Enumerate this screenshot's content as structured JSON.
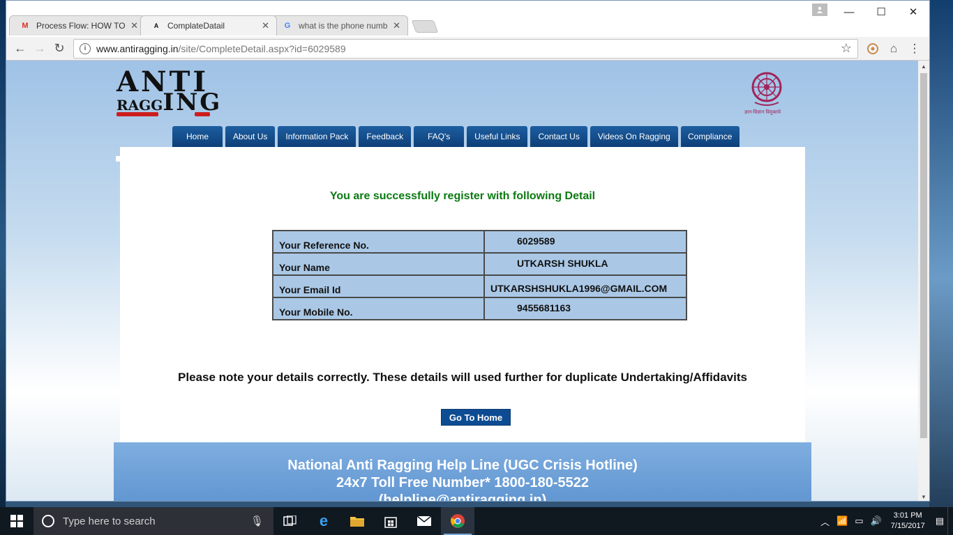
{
  "browser": {
    "tabs": [
      {
        "title": "Process Flow: HOW TO F",
        "icon": "gmail-icon",
        "icon_glyph": "M",
        "active": false
      },
      {
        "title": "ComplateDatail",
        "icon": "antiragging-favicon",
        "icon_glyph": "A",
        "active": true
      },
      {
        "title": "what is the phone numb",
        "icon": "google-icon",
        "icon_glyph": "G",
        "active": false
      }
    ],
    "close_glyph": "✕",
    "url_host": "www.antiragging.in",
    "url_path": "/site/CompleteDetail.aspx?id=6029589",
    "window_controls": {
      "minimize": "—",
      "maximize": "☐",
      "close": "✕"
    }
  },
  "site": {
    "logo_line1": "ANTI",
    "logo_line2_a": "RAGG",
    "logo_line2_b": "ING",
    "ugc_caption": "ज्ञान-विज्ञान विमुक्तये",
    "nav": [
      "Home",
      "About Us",
      "Information Pack",
      "Feedback",
      "FAQ's",
      "Useful Links",
      "Contact Us",
      "Videos On Ragging",
      "Compliance"
    ],
    "success_message": "You are successfully register with following Detail",
    "details": [
      {
        "label": "Your Reference No.",
        "value": "6029589"
      },
      {
        "label": "Your Name",
        "value": "UTKARSH SHUKLA"
      },
      {
        "label": "Your Email Id",
        "value": "UTKARSHSHUKLA1996@GMAIL.COM"
      },
      {
        "label": "Your Mobile No.",
        "value": "9455681163"
      }
    ],
    "note": "Please note your details correctly. These details will used further for duplicate Undertaking/Affidavits",
    "go_home": "Go To Home",
    "helpline": {
      "line1": "National Anti Ragging Help Line (UGC Crisis Hotline)",
      "line2": "24x7 Toll Free Number* 1800-180-5522",
      "line3": "(helpline@antiragging.in)"
    }
  },
  "taskbar": {
    "search_placeholder": "Type here to search",
    "time": "3:01 PM",
    "date": "7/15/2017"
  },
  "colors": {
    "nav_blue": "#0d3f78",
    "success_green": "#0b7a12",
    "table_blue": "#aac8e6",
    "logo_red": "#cc1d1d"
  }
}
